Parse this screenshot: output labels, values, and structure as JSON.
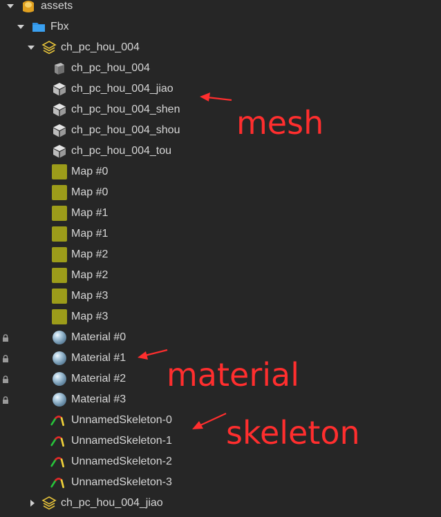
{
  "tree": {
    "assets": "assets",
    "fbx": "Fbx",
    "model": "ch_pc_hou_004",
    "meshes": [
      "ch_pc_hou_004",
      "ch_pc_hou_004_jiao",
      "ch_pc_hou_004_shen",
      "ch_pc_hou_004_shou",
      "ch_pc_hou_004_tou"
    ],
    "maps": [
      "Map #0",
      "Map #0",
      "Map #1",
      "Map #1",
      "Map #2",
      "Map #2",
      "Map #3",
      "Map #3"
    ],
    "materials": [
      "Material #0",
      "Material #1",
      "Material #2",
      "Material #3"
    ],
    "skeletons": [
      "UnnamedSkeleton-0",
      "UnnamedSkeleton-1",
      "UnnamedSkeleton-2",
      "UnnamedSkeleton-3"
    ],
    "next_model": "ch_pc_hou_004_jiao"
  },
  "annotations": {
    "mesh": "mesh",
    "material": "material",
    "skeleton": "skeleton"
  },
  "colors": {
    "background": "#262626",
    "text": "#d6d6d6",
    "folder": "#2f8fe0",
    "map_swatch": "#9c9c1a",
    "annotation": "#ff2e2e"
  }
}
